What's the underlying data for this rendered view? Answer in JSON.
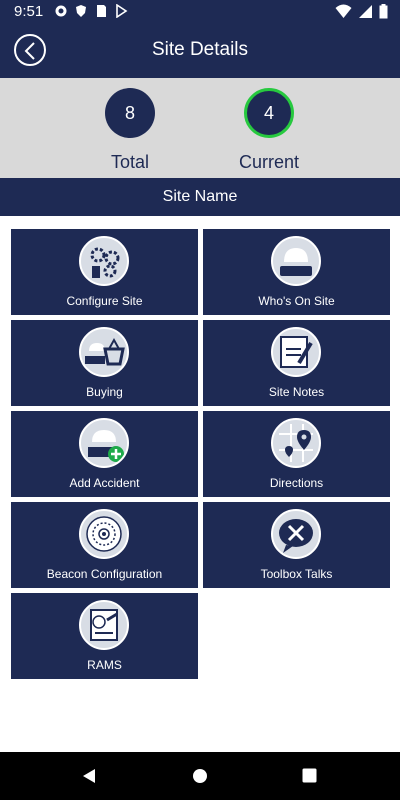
{
  "status_bar": {
    "time": "9:51"
  },
  "header": {
    "title": "Site Details"
  },
  "stats": {
    "total": {
      "value": "8",
      "label": "Total"
    },
    "current": {
      "value": "4",
      "label": "Current"
    }
  },
  "site": {
    "name": "Site Name"
  },
  "tiles": [
    {
      "label": "Configure Site",
      "icon": "settings-icon"
    },
    {
      "label": "Who's On Site",
      "icon": "hard-hat-icon"
    },
    {
      "label": "Buying",
      "icon": "shopping-basket-icon"
    },
    {
      "label": "Site Notes",
      "icon": "notes-icon"
    },
    {
      "label": "Add Accident",
      "icon": "accident-add-icon"
    },
    {
      "label": "Directions",
      "icon": "map-pin-icon"
    },
    {
      "label": "Beacon Configuration",
      "icon": "beacon-icon"
    },
    {
      "label": "Toolbox Talks",
      "icon": "tools-icon"
    },
    {
      "label": "RAMS",
      "icon": "rams-doc-icon"
    }
  ],
  "colors": {
    "primary": "#1e2a54",
    "stats_bg": "#d9d9d9",
    "current_ring": "#27c93f"
  }
}
